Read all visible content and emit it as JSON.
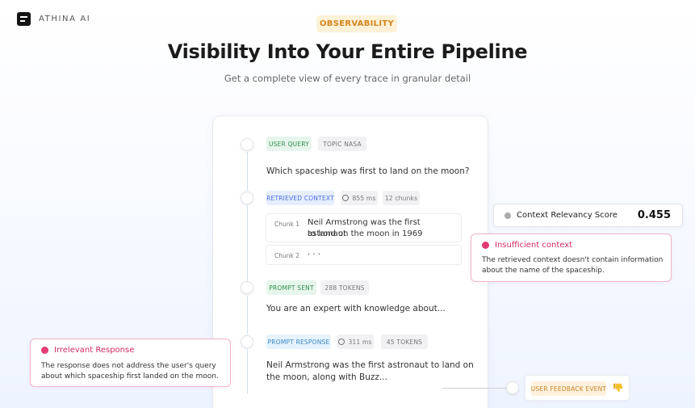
{
  "brand": {
    "name": "ATHINA AI"
  },
  "hero": {
    "badge": "OBSERVABILITY",
    "title": "Visibility Into Your Entire Pipeline",
    "subtitle": "Get a complete view of every trace in granular detail"
  },
  "trace": {
    "user_query": {
      "tag": "USER QUERY",
      "topic": "TOPIC NASA",
      "text": "Which spaceship was first to land on the moon?"
    },
    "retrieved_context": {
      "tag": "RETRIEVED CONTEXT",
      "latency": "855 ms",
      "chunks_count": "12 chunks",
      "chunks": [
        {
          "label": "Chunk 1",
          "text_line1": "Neil Armstrong was the first astronaut",
          "text_line2": "to land on the moon in 1969"
        },
        {
          "label": "Chunk 2",
          "text_line1": "· · ·"
        }
      ]
    },
    "prompt_sent": {
      "tag": "PROMPT SENT",
      "tokens": "288 TOKENS",
      "text": "You are an expert with knowledge about..."
    },
    "prompt_response": {
      "tag": "PROMPT RESPONSE",
      "latency": "311 ms",
      "tokens": "45 TOKENS",
      "text_line1": "Neil Armstrong was the first astronaut to land on",
      "text_line2": "the moon, along with Buzz..."
    }
  },
  "metric": {
    "label": "Context Relevancy Score",
    "value": "0.455"
  },
  "alerts": {
    "insufficient": {
      "title": "Insufficient context",
      "body_line1": "The retrieved context doesn't contain information",
      "body_line2": "about the name of the spaceship."
    },
    "irrelevant": {
      "title": "Irrelevant Response",
      "body_line1": "The response does not address the user's query",
      "body_line2": "about which spaceship first landed on the moon."
    }
  },
  "feedback": {
    "tag": "USER FEEDBACK EVENT",
    "icon": "thumbs-down-icon"
  },
  "colors": {
    "accent_pink": "#d42a64",
    "accent_orange": "#d4861c",
    "timeline": "#cfe3f3"
  }
}
